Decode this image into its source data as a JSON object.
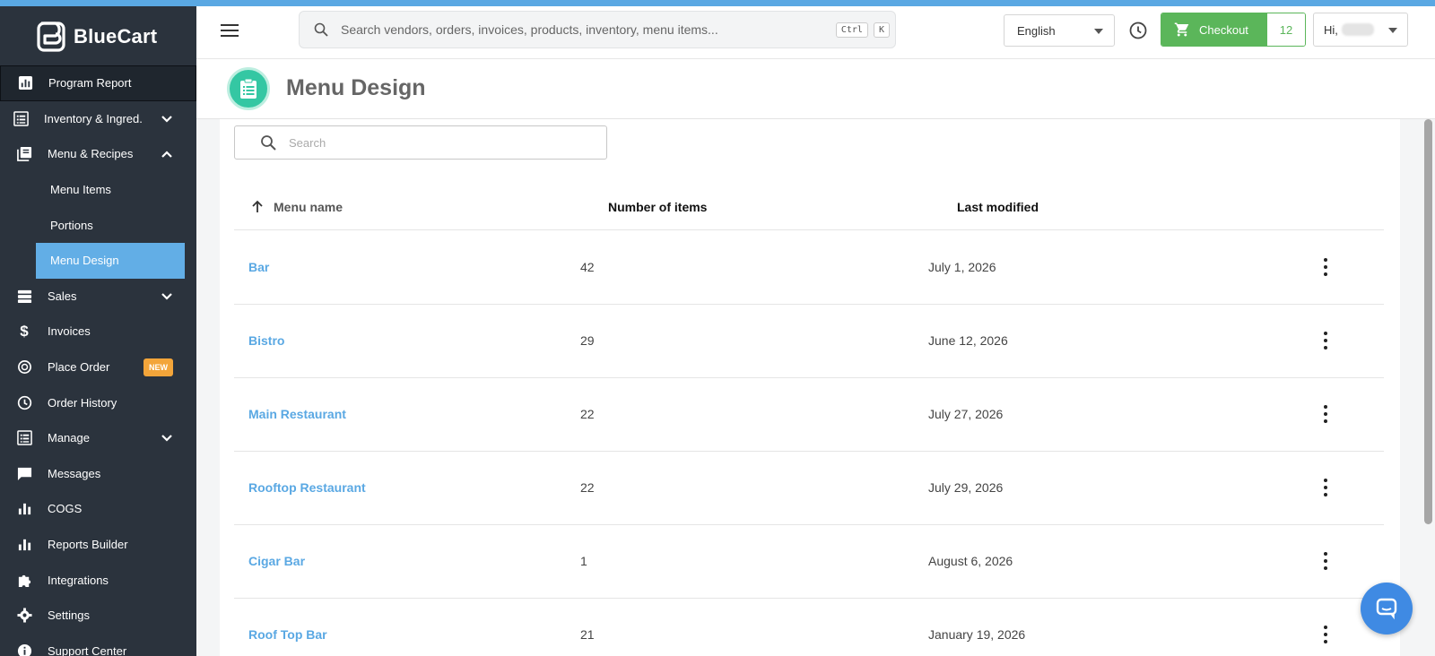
{
  "app": {
    "name": "BlueCart"
  },
  "colors": {
    "accent": "#5aa8e3",
    "sidebar_bg": "#2b333d",
    "checkout_green": "#5bb65a",
    "new_badge": "#f3a53a",
    "title_icon": "#34c7a3"
  },
  "sidebar": {
    "items": [
      {
        "label": "Program Report",
        "icon": "bar-chart-icon"
      },
      {
        "label": "Inventory & Ingred.",
        "icon": "list-icon"
      },
      {
        "label": "Menu & Recipes",
        "icon": "book-icon"
      },
      {
        "label": "Sales",
        "icon": "stack-icon"
      },
      {
        "label": "Invoices",
        "icon": "dollar-icon"
      },
      {
        "label": "Place Order",
        "icon": "coins-icon",
        "badge": "NEW"
      },
      {
        "label": "Order History",
        "icon": "clock-icon"
      },
      {
        "label": "Manage",
        "icon": "list-icon"
      },
      {
        "label": "Messages",
        "icon": "message-icon"
      },
      {
        "label": "COGS",
        "icon": "bar-chart-icon"
      },
      {
        "label": "Reports Builder",
        "icon": "bar-chart-icon"
      },
      {
        "label": "Integrations",
        "icon": "puzzle-icon"
      },
      {
        "label": "Settings",
        "icon": "gear-icon"
      },
      {
        "label": "Support Center",
        "icon": "info-icon"
      }
    ],
    "sub_items": [
      {
        "label": "Menu Items"
      },
      {
        "label": "Portions"
      },
      {
        "label": "Menu Design"
      }
    ]
  },
  "header": {
    "search_placeholder": "Search vendors, orders, invoices, products, inventory, menu items...",
    "kbd_ctrl": "Ctrl",
    "kbd_k": "K",
    "language": "English",
    "checkout_label": "Checkout",
    "cart_count": "12",
    "greeting": "Hi,"
  },
  "page": {
    "title": "Menu Design",
    "search_placeholder": "Search"
  },
  "table": {
    "columns": [
      "Menu name",
      "Number of items",
      "Last modified"
    ],
    "rows": [
      {
        "name": "Bar",
        "count": "42",
        "modified": "July 1, 2026"
      },
      {
        "name": "Bistro",
        "count": "29",
        "modified": "June 12, 2026"
      },
      {
        "name": "Main Restaurant",
        "count": "22",
        "modified": "July 27, 2026"
      },
      {
        "name": "Rooftop Restaurant",
        "count": "22",
        "modified": "July 29, 2026"
      },
      {
        "name": "Cigar Bar",
        "count": "1",
        "modified": "August 6, 2026"
      },
      {
        "name": "Roof Top Bar",
        "count": "21",
        "modified": "January 19, 2026"
      }
    ]
  }
}
